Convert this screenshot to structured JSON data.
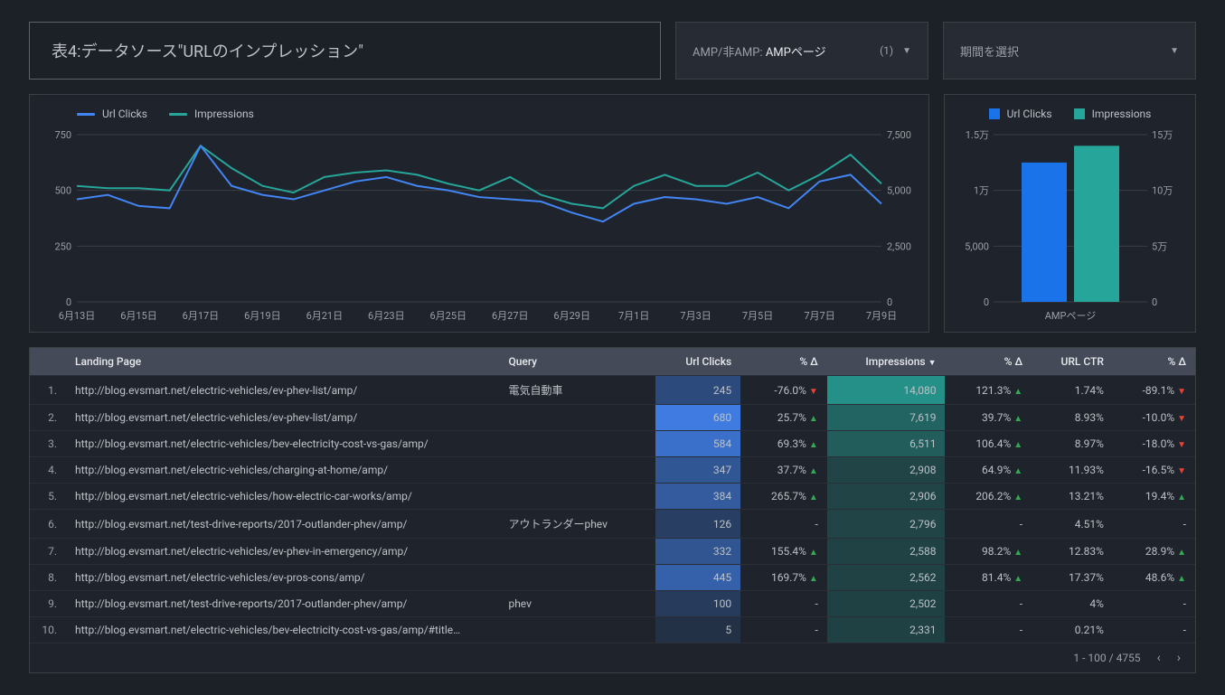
{
  "header": {
    "title": "表4:データソース\"URLのインプレッション\"",
    "filter_label": "AMP/非AMP:",
    "filter_value": "AMPページ",
    "filter_count": "(1)",
    "date_label": "期間を選択"
  },
  "colors": {
    "clicks": "#4285f4",
    "impressions": "#26a69a"
  },
  "chart_data": [
    {
      "type": "line",
      "title": "",
      "legend": [
        "Url Clicks",
        "Impressions"
      ],
      "x": [
        "6月13日",
        "6月14日",
        "6月15日",
        "6月16日",
        "6月17日",
        "6月18日",
        "6月19日",
        "6月20日",
        "6月21日",
        "6月22日",
        "6月23日",
        "6月24日",
        "6月25日",
        "6月26日",
        "6月27日",
        "6月28日",
        "6月29日",
        "6月30日",
        "7月1日",
        "7月2日",
        "7月3日",
        "7月4日",
        "7月5日",
        "7月6日",
        "7月7日",
        "7月8日",
        "7月9日"
      ],
      "x_ticks": [
        "6月13日",
        "6月15日",
        "6月17日",
        "6月19日",
        "6月21日",
        "6月23日",
        "6月25日",
        "6月27日",
        "6月29日",
        "7月1日",
        "7月3日",
        "7月5日",
        "7月7日",
        "7月9日"
      ],
      "series": [
        {
          "name": "Url Clicks",
          "axis": "left",
          "values": [
            460,
            480,
            430,
            420,
            700,
            520,
            480,
            460,
            500,
            540,
            560,
            520,
            500,
            470,
            460,
            450,
            400,
            360,
            440,
            470,
            460,
            440,
            470,
            420,
            540,
            570,
            440
          ]
        },
        {
          "name": "Impressions",
          "axis": "right",
          "values": [
            5200,
            5100,
            5100,
            5000,
            7000,
            6000,
            5200,
            4900,
            5600,
            5800,
            5900,
            5700,
            5300,
            5000,
            5600,
            4800,
            4400,
            4200,
            5200,
            5700,
            5200,
            5200,
            5800,
            5000,
            5700,
            6600,
            5300
          ]
        }
      ],
      "y_left_ticks": [
        0,
        250,
        500,
        750
      ],
      "y_right_ticks": [
        0,
        2500,
        5000,
        7500
      ],
      "y_left_range": [
        0,
        750
      ],
      "y_right_range": [
        0,
        7500
      ]
    },
    {
      "type": "bar",
      "legend": [
        "Url Clicks",
        "Impressions"
      ],
      "categories": [
        "AMPページ"
      ],
      "series": [
        {
          "name": "Url Clicks",
          "axis": "left",
          "values": [
            12500
          ]
        },
        {
          "name": "Impressions",
          "axis": "right",
          "values": [
            140000
          ]
        }
      ],
      "y_left_ticks": [
        "0",
        "5,000",
        "1万",
        "1.5万"
      ],
      "y_right_ticks": [
        "0",
        "5万",
        "10万",
        "15万"
      ],
      "y_left_range": [
        0,
        15000
      ],
      "y_right_range": [
        0,
        150000
      ]
    }
  ],
  "table": {
    "columns": [
      "Landing Page",
      "Query",
      "Url Clicks",
      "% Δ",
      "Impressions",
      "% Δ",
      "URL CTR",
      "% Δ"
    ],
    "sort_col": "Impressions",
    "rows": [
      {
        "idx": "1.",
        "lp": "http://blog.evsmart.net/electric-vehicles/ev-phev-list/amp/",
        "q": "電気自動車",
        "clicks": 245,
        "clicks_pct": "-76.0%",
        "clicks_dir": "down",
        "impr": 14080,
        "impr_pct": "121.3%",
        "impr_dir": "up",
        "ctr": "1.74%",
        "ctr_pct": "-89.1%",
        "ctr_dir": "down"
      },
      {
        "idx": "2.",
        "lp": "http://blog.evsmart.net/electric-vehicles/ev-phev-list/amp/",
        "q": "",
        "clicks": 680,
        "clicks_pct": "25.7%",
        "clicks_dir": "up",
        "impr": 7619,
        "impr_pct": "39.7%",
        "impr_dir": "up",
        "ctr": "8.93%",
        "ctr_pct": "-10.0%",
        "ctr_dir": "down"
      },
      {
        "idx": "3.",
        "lp": "http://blog.evsmart.net/electric-vehicles/bev-electricity-cost-vs-gas/amp/",
        "q": "",
        "clicks": 584,
        "clicks_pct": "69.3%",
        "clicks_dir": "up",
        "impr": 6511,
        "impr_pct": "106.4%",
        "impr_dir": "up",
        "ctr": "8.97%",
        "ctr_pct": "-18.0%",
        "ctr_dir": "down"
      },
      {
        "idx": "4.",
        "lp": "http://blog.evsmart.net/electric-vehicles/charging-at-home/amp/",
        "q": "",
        "clicks": 347,
        "clicks_pct": "37.7%",
        "clicks_dir": "up",
        "impr": 2908,
        "impr_pct": "64.9%",
        "impr_dir": "up",
        "ctr": "11.93%",
        "ctr_pct": "-16.5%",
        "ctr_dir": "down"
      },
      {
        "idx": "5.",
        "lp": "http://blog.evsmart.net/electric-vehicles/how-electric-car-works/amp/",
        "q": "",
        "clicks": 384,
        "clicks_pct": "265.7%",
        "clicks_dir": "up",
        "impr": 2906,
        "impr_pct": "206.2%",
        "impr_dir": "up",
        "ctr": "13.21%",
        "ctr_pct": "19.4%",
        "ctr_dir": "up"
      },
      {
        "idx": "6.",
        "lp": "http://blog.evsmart.net/test-drive-reports/2017-outlander-phev/amp/",
        "q": "アウトランダーphev",
        "clicks": 126,
        "clicks_pct": "-",
        "clicks_dir": "",
        "impr": 2796,
        "impr_pct": "-",
        "impr_dir": "",
        "ctr": "4.51%",
        "ctr_pct": "-",
        "ctr_dir": ""
      },
      {
        "idx": "7.",
        "lp": "http://blog.evsmart.net/electric-vehicles/ev-phev-in-emergency/amp/",
        "q": "",
        "clicks": 332,
        "clicks_pct": "155.4%",
        "clicks_dir": "up",
        "impr": 2588,
        "impr_pct": "98.2%",
        "impr_dir": "up",
        "ctr": "12.83%",
        "ctr_pct": "28.9%",
        "ctr_dir": "up"
      },
      {
        "idx": "8.",
        "lp": "http://blog.evsmart.net/electric-vehicles/ev-pros-cons/amp/",
        "q": "",
        "clicks": 445,
        "clicks_pct": "169.7%",
        "clicks_dir": "up",
        "impr": 2562,
        "impr_pct": "81.4%",
        "impr_dir": "up",
        "ctr": "17.37%",
        "ctr_pct": "48.6%",
        "ctr_dir": "up"
      },
      {
        "idx": "9.",
        "lp": "http://blog.evsmart.net/test-drive-reports/2017-outlander-phev/amp/",
        "q": "phev",
        "clicks": 100,
        "clicks_pct": "-",
        "clicks_dir": "",
        "impr": 2502,
        "impr_pct": "-",
        "impr_dir": "",
        "ctr": "4%",
        "ctr_pct": "-",
        "ctr_dir": ""
      },
      {
        "idx": "10.",
        "lp": "http://blog.evsmart.net/electric-vehicles/bev-electricity-cost-vs-gas/amp/#title…",
        "q": "",
        "clicks": 5,
        "clicks_pct": "-",
        "clicks_dir": "",
        "impr": 2331,
        "impr_pct": "-",
        "impr_dir": "",
        "ctr": "0.21%",
        "ctr_pct": "-",
        "ctr_dir": ""
      }
    ],
    "pager": "1 - 100 / 4755"
  }
}
